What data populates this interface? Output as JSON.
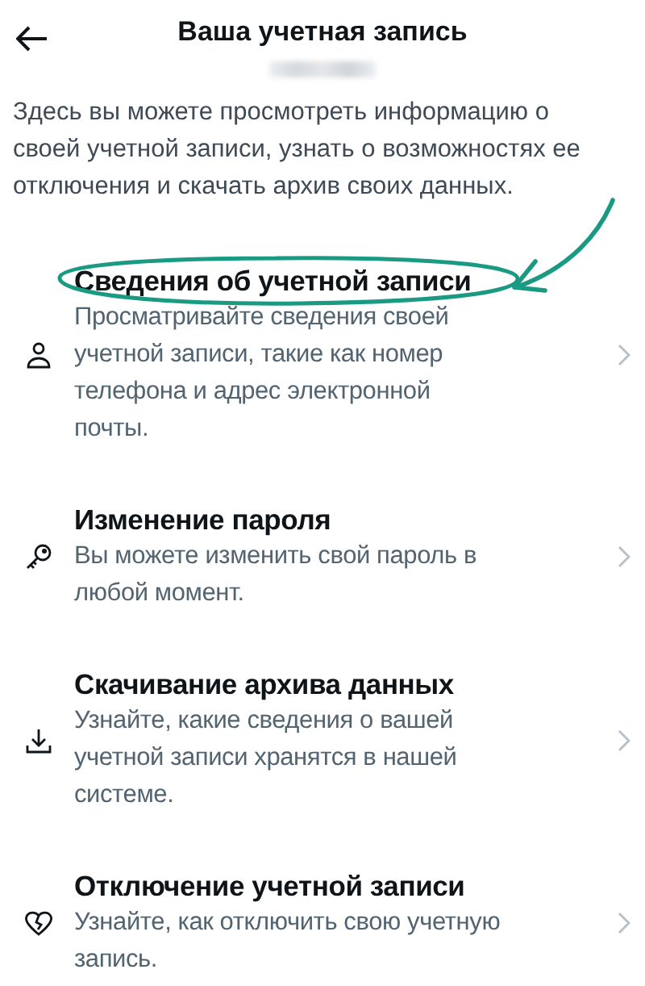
{
  "header": {
    "title": "Ваша учетная запись",
    "username_blurred": true
  },
  "description": "Здесь вы можете просмотреть информацию о своей учетной записи, узнать о возможностях ее отключения и скачать архив своих данных.",
  "items": [
    {
      "kind": "person",
      "title": "Сведения об учетной записи",
      "subtitle": "Просматривайте сведения своей учетной записи, такие как номер телефона и адрес электронной почты.",
      "highlighted": true
    },
    {
      "kind": "key",
      "title": "Изменение пароля",
      "subtitle": "Вы можете изменить свой пароль в любой момент.",
      "highlighted": false
    },
    {
      "kind": "download",
      "title": "Скачивание архива данных",
      "subtitle": "Узнайте, какие сведения о вашей учетной записи хранятся в нашей системе.",
      "highlighted": false
    },
    {
      "kind": "broken-heart",
      "title": "Отключение учетной записи",
      "subtitle": "Узнайте, как отключить свою учетную запись.",
      "highlighted": false
    }
  ]
}
